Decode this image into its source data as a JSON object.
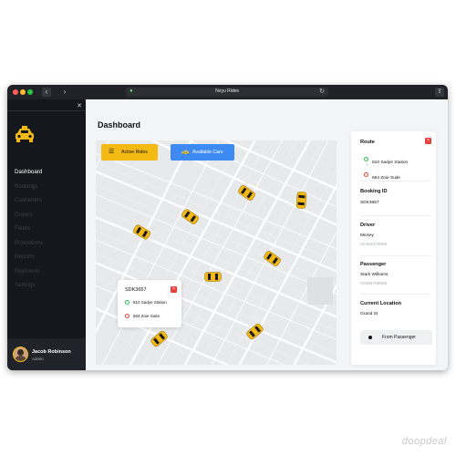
{
  "browser": {
    "page_title": "Noyu Rides",
    "traffic_lights": [
      "#ff5f57",
      "#febc2e",
      "#28c840"
    ]
  },
  "sidebar": {
    "items": [
      {
        "label": "Dashboard",
        "active": true
      },
      {
        "label": "Bookings",
        "active": false
      },
      {
        "label": "Customers",
        "active": false
      },
      {
        "label": "Drivers",
        "active": false
      },
      {
        "label": "Fleets",
        "active": false
      },
      {
        "label": "Promotions",
        "active": false
      },
      {
        "label": "Reports",
        "active": false
      },
      {
        "label": "Payments",
        "active": false
      },
      {
        "label": "Settings",
        "active": false
      }
    ],
    "user": {
      "name": "Jacob Robinson",
      "role": "Admin"
    }
  },
  "main": {
    "title": "Dashboard",
    "map": {
      "active_rides_label": "Active Rides",
      "available_cars_label": "Available Cars",
      "popup": {
        "booking_id": "SDK3657",
        "from": "810 Sadye Station",
        "to": "664 Zoie Suite"
      }
    },
    "panel": {
      "route_heading": "Route",
      "route_from": "810 Sadye Station",
      "route_to": "664 Zoie Suite",
      "booking_id_heading": "Booking ID",
      "booking_id": "SDK3657",
      "driver_heading": "Driver",
      "driver_name": "Mickey",
      "driver_phone": "01465374865",
      "passenger_heading": "Passenger",
      "passenger_name": "Stark Williams",
      "passenger_phone": "01565758665",
      "location_heading": "Current Location",
      "location": "Grand St",
      "action_label": "From Passenger"
    }
  },
  "colors": {
    "accent_yellow": "#f5b915",
    "accent_blue": "#3d8bf2",
    "danger_red": "#e6413b",
    "success_green": "#2cc05a",
    "sidebar_bg": "#14181d"
  },
  "watermark": "doopdeal"
}
